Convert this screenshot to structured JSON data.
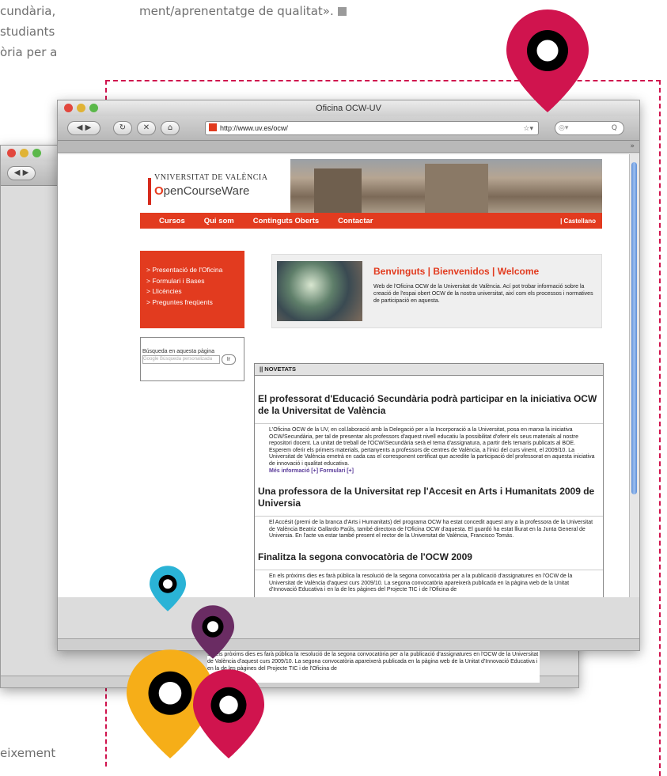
{
  "article": {
    "frag_1": "cundària,",
    "frag_2": "studiants",
    "frag_3": "òria per a",
    "frag_4": "ment/aprenentatge de qualitat».",
    "frag_5": "eixement"
  },
  "browser": {
    "window_title": "Oficina OCW-UV",
    "url": "http://www.uv.es/ocw/",
    "search_placeholder": "Q"
  },
  "site": {
    "university": "VNIVERSITAT DE VALÈNCIA",
    "brand_o": "O",
    "brand_rest": "penCourseWare",
    "nav": [
      "Cursos",
      "Qui som",
      "Continguts Oberts",
      "Contactar"
    ],
    "lang": "| Castellano",
    "side_menu": [
      "> Presentació de l'Oficina",
      "> Formulari i Bases",
      "> Llicències",
      "> Preguntes freqüents"
    ],
    "search_label": "Búsqueda en aquesta pàgina",
    "search_placeholder": "Google  Búsqueda personalizada",
    "search_button": "Ir",
    "welcome_title": "Benvinguts | Bienvenidos | Welcome",
    "welcome_text": "Web de l'Oficina OCW de la Universitat de València. Ací pot trobar informació sobre la creació de l'espai obert OCW de la nostra universitat, així com els processos i normatives de participació en aquesta.",
    "news_header": "|| NOVETATS",
    "news": [
      {
        "title": "El professorat d'Educació Secundària podrà participar en la iniciativa OCW de la Universitat de València",
        "body": "L'Oficina OCW de la UV, en col.laboració amb la Delegació per a la Incorporació a la Universitat, posa en marxa la iniciativa OCW/Secundària, per tal de presentar als professors d'aquest nivell educatiu la possibilitat d'oferir els seus materials al nostre repositori docent. La unitat de treball de l'OCW/Secundària serà el tema d'assignatura, a partir dels temaris publicats al BOE. Esperem oferir els primers materials, pertanyents a professors de centres de València, a l'inici del curs vinent, el 2009/10. La Universitat de València emetrà en cada cas el corresponent certificat que acredite la participació del professorat en aquesta iniciativa de innovació i qualitat educativa.",
        "link": "Més informació [+] Formulari [+]"
      },
      {
        "title": "Una professora de la Universitat rep l'Accesit en Arts i Humanitats 2009 de Universia",
        "body": "El Accésit (premi de la branca d'Arts i Humanitats) del programa OCW ha estat concedit aquest any a la professora de la Universitat de València Beatriz Gallardo Paúls, també directora de l'Oficina OCW d'aquesta. El guardó ha estat lliurat en la Junta General de Universia. En l'acte va estar també present el rector de la Universitat de València, Francisco Tomás."
      },
      {
        "title": "Finalitza la segona convocatòria de l'OCW 2009",
        "body": "En els pròxims dies es farà pública la resolució de la segona convocatòria per a la publicació d'assignatures en l'OCW de la Universitat de València d'aquest curs 2009/10. La segona convocatòria apareixerà publicada en la pàgina web de la Unitat d'Innovació Educativa i en la de les pàgines del Projecte TIC i de l'Oficina de"
      }
    ],
    "back_text": "En els pròxims dies es farà pública la resolució de la segona convocatòria per a la publicació d'assignatures en l'OCW de la Universitat de València d'aquest curs 2009/10. La segona convocatòria apareixerà publicada en la pàgina web de la Unitat d'Innovació Educativa i en la de les pàgines del Projecte TIC i de l'Oficina de"
  },
  "colors": {
    "pin_red": "#d0144e",
    "pin_cyan": "#2ab3d6",
    "pin_purple": "#6a2c63",
    "pin_yellow": "#f6ae18",
    "site_red": "#e23b1f"
  }
}
